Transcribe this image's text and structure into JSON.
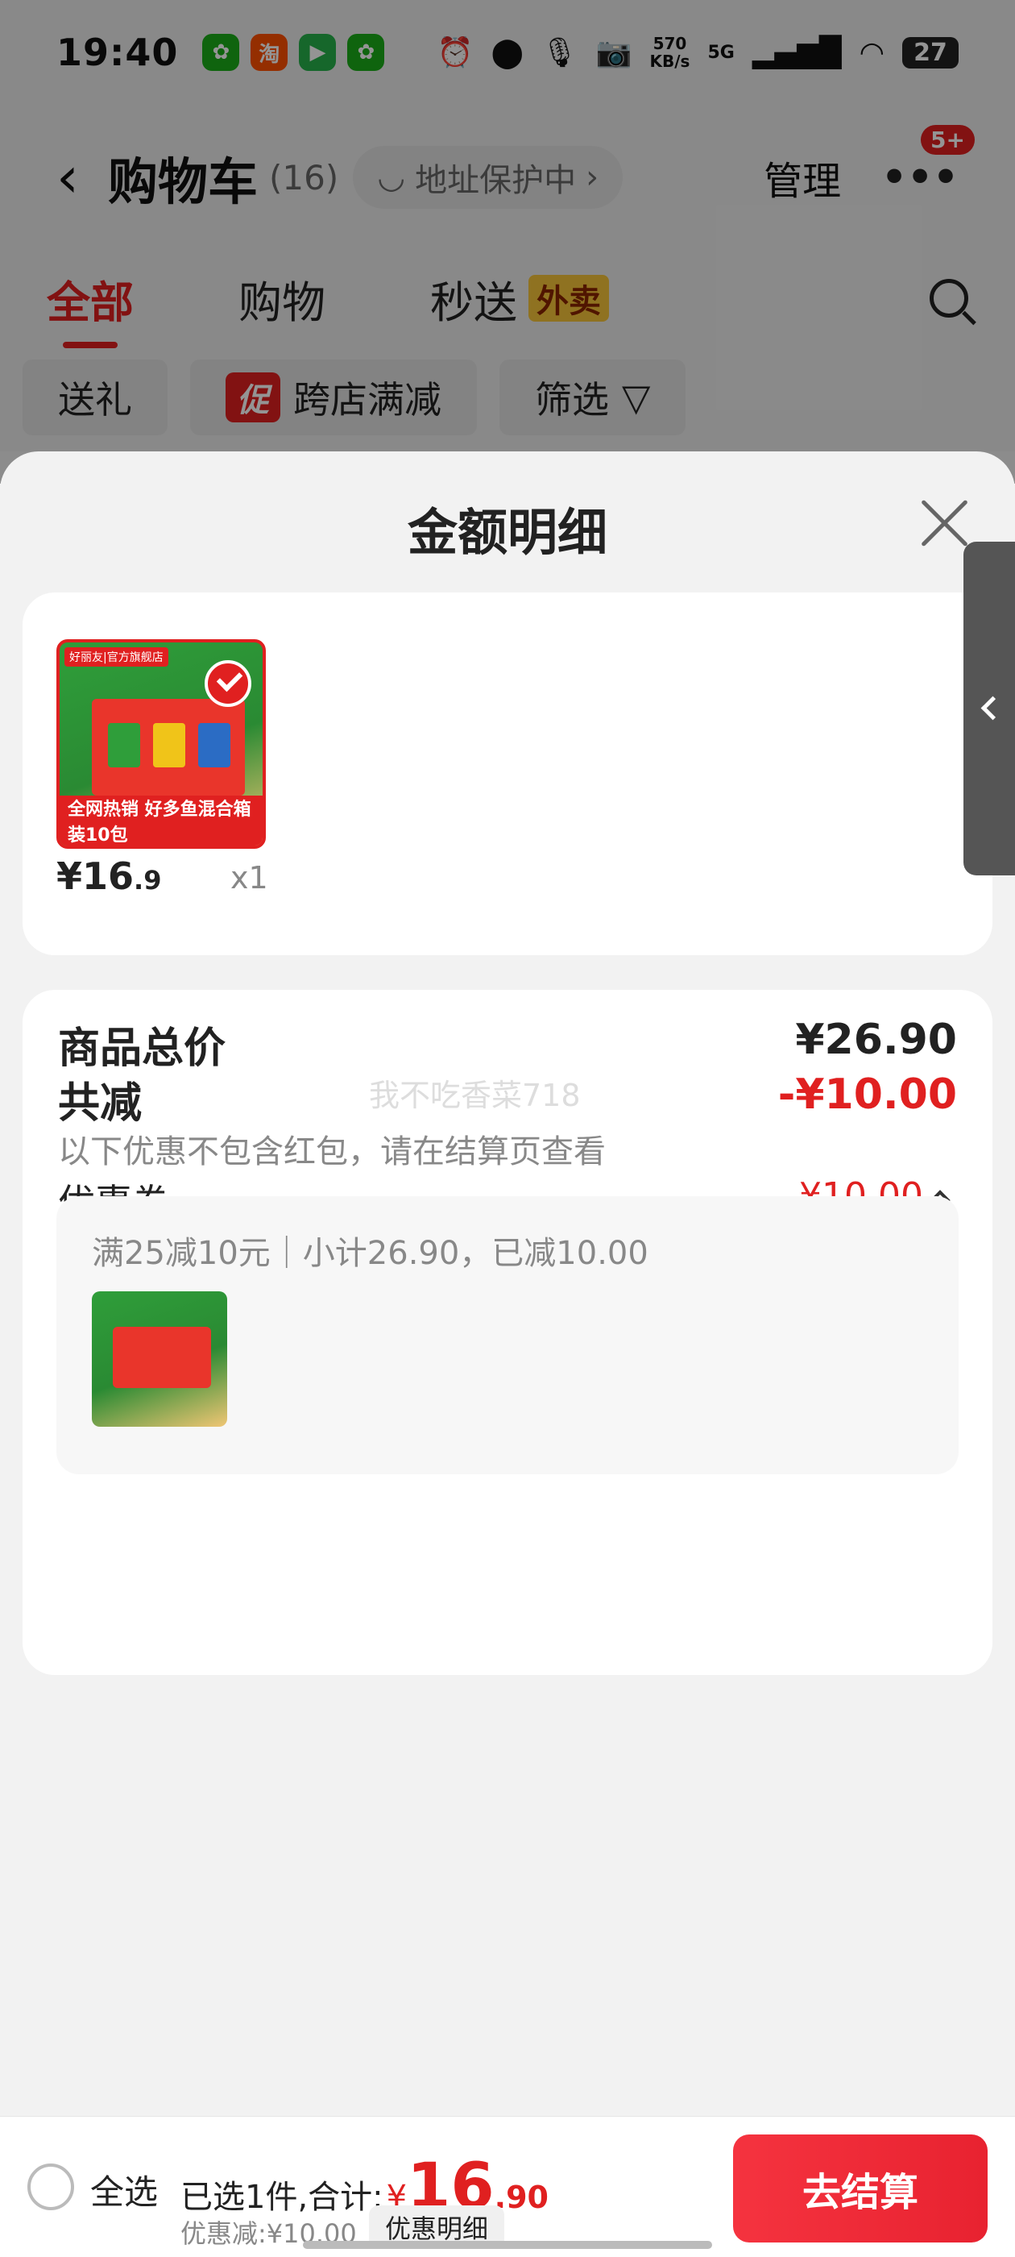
{
  "status_bar": {
    "time": "19:40",
    "apps": [
      {
        "icon": "wechat-icon",
        "glyph": "✿",
        "color": "#1aad19"
      },
      {
        "icon": "taobao-icon",
        "glyph": "淘",
        "color": "#ff5000"
      },
      {
        "icon": "video-app-icon",
        "glyph": "▶",
        "color": "#27b24a"
      },
      {
        "icon": "wechat-icon",
        "glyph": "✿",
        "color": "#1aad19"
      }
    ],
    "net_speed_value": "570",
    "net_speed_unit": "KB/s",
    "network": "5G",
    "battery": "27"
  },
  "header": {
    "title": "购物车",
    "count": "(16)",
    "address_protect": "地址保护中",
    "manage": "管理",
    "more_badge": "5+"
  },
  "tabs": [
    {
      "label": "全部",
      "active": true
    },
    {
      "label": "购物",
      "active": false
    },
    {
      "label": "秒送",
      "active": false,
      "tag": "外卖"
    }
  ],
  "filters": {
    "gift": "送礼",
    "promo_tag": "促",
    "cross_store": "跨店满减",
    "filter": "筛选"
  },
  "sheet": {
    "title": "金额明细",
    "product": {
      "price_int": "¥16",
      "price_dec": ".9",
      "qty": "x1",
      "brand": "好丽友|官方旗舰店",
      "banner": "全网热销 好多鱼混合箱装10包"
    },
    "summary": {
      "total_label": "商品总价",
      "total_value": "¥26.90",
      "reduce_label": "共减",
      "reduce_value": "-¥10.00",
      "note": "以下优惠不包含红包，请在结算页查看",
      "coupon_label": "优惠券",
      "coupon_value": "-¥10.00",
      "coupon_desc": "满25减10元｜小计26.90，已减10.00",
      "watermark": "我不吃香菜718"
    }
  },
  "bottom_bar": {
    "select_all": "全选",
    "selected_text": "已选1件,合计:",
    "currency": "¥",
    "total_int": "16",
    "total_dec": ".90",
    "discount_text": "优惠减:¥10.00",
    "detail_label": "优惠明细",
    "checkout": "去结算"
  },
  "colors": {
    "accent": "#e02020",
    "tag_yellow": "#f7c53a"
  }
}
